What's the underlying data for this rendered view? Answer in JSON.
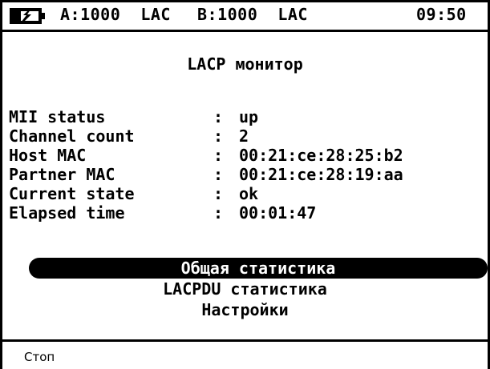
{
  "status_bar": {
    "battery_icon": "battery-charging-icon",
    "port_a": "A:1000  LAC",
    "port_b": "B:1000  LAC",
    "clock": "09:50"
  },
  "screen": {
    "title": "LACP монитор"
  },
  "info": [
    {
      "label": "MII status",
      "colon": ":",
      "value": "up"
    },
    {
      "label": "Channel count",
      "colon": ":",
      "value": "2"
    },
    {
      "label": "Host MAC",
      "colon": ":",
      "value": "00:21:ce:28:25:b2"
    },
    {
      "label": "Partner MAC",
      "colon": ":",
      "value": "00:21:ce:28:19:aa"
    },
    {
      "label": "Current state",
      "colon": ":",
      "value": "ok"
    },
    {
      "label": "Elapsed time",
      "colon": ":",
      "value": "00:01:47"
    }
  ],
  "menu": [
    {
      "label": "Общая статистика",
      "selected": true
    },
    {
      "label": "LACPDU статистика",
      "selected": false
    },
    {
      "label": "Настройки",
      "selected": false
    }
  ],
  "softkeys": {
    "f1": "Стоп"
  },
  "colors": {
    "foreground": "#000000",
    "background": "#ffffff"
  }
}
